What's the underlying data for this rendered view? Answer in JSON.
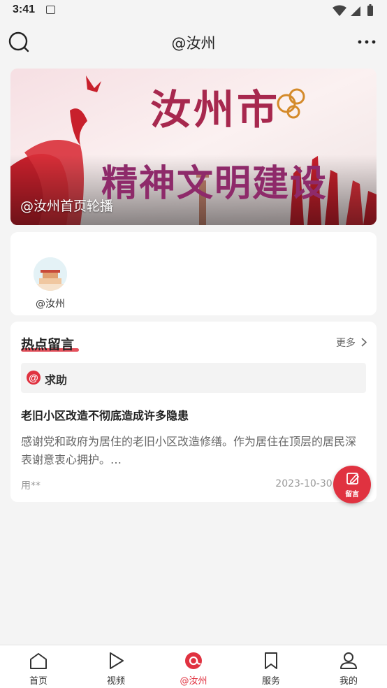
{
  "status_bar": {
    "time": "3:41"
  },
  "header": {
    "title": "@汝州"
  },
  "banner": {
    "title_line1": "汝州市",
    "title_line2": "精神文明建设",
    "caption": "@汝州首页轮播"
  },
  "account": {
    "name": "@汝州"
  },
  "hot_messages": {
    "title": "热点留言",
    "more_label": "更多",
    "tag": {
      "icon_text": "@",
      "label": "求助"
    },
    "item": {
      "title": "老旧小区改造不彻底造成许多隐患",
      "excerpt": "感谢党和政府为居住的老旧小区改造修缮。作为居住在顶层的居民深表谢意衷心拥护。…",
      "user": "用**",
      "date": "2023-10-30 1"
    }
  },
  "fab": {
    "label": "留言"
  },
  "tabs": [
    {
      "label": "首页",
      "icon": "home-icon"
    },
    {
      "label": "视频",
      "icon": "play-icon"
    },
    {
      "label": "@汝州",
      "icon": "at-ruzhou-icon",
      "active": true
    },
    {
      "label": "服务",
      "icon": "bookmark-icon"
    },
    {
      "label": "我的",
      "icon": "user-icon"
    }
  ],
  "colors": {
    "accent": "#e03240",
    "background": "#f4f4f4"
  }
}
